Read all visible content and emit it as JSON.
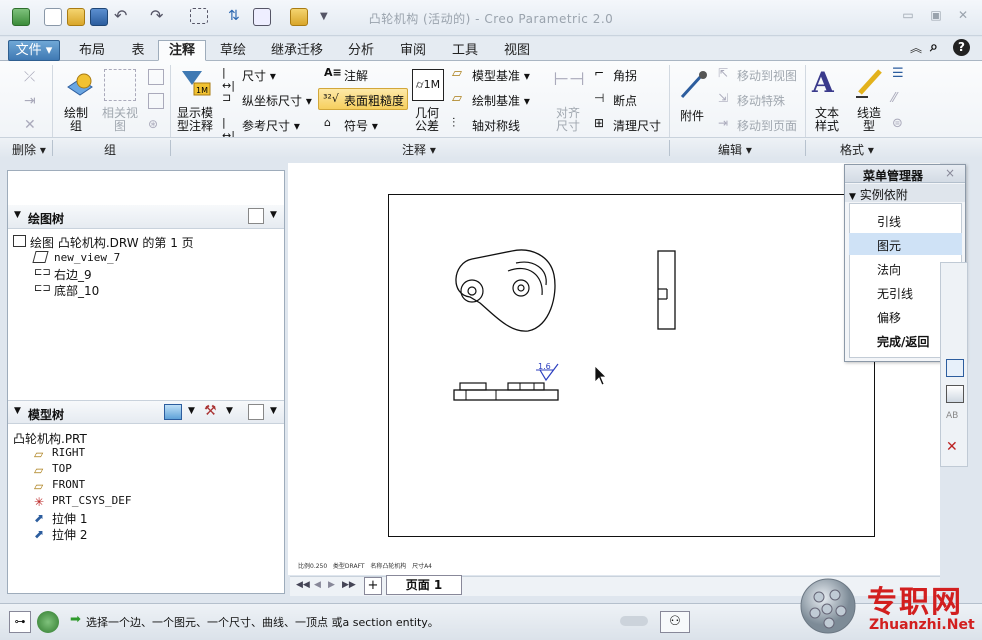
{
  "window": {
    "title": "凸轮机构 (活动的) - Creo Parametric 2.0"
  },
  "tabs": {
    "file": "文件",
    "items": [
      "布局",
      "表",
      "注释",
      "草绘",
      "继承迁移",
      "分析",
      "审阅",
      "工具",
      "视图"
    ],
    "active_index": 2
  },
  "ribbon": {
    "delete": {
      "group_label": "删除"
    },
    "group": {
      "make_group": "绘制\n组",
      "related_view": "相关视\n图",
      "group_label": "组"
    },
    "annotate": {
      "show_model_annotations": "显示模\n型注释",
      "dimension": "尺寸",
      "ordinate_dimension": "纵坐标尺寸",
      "reference_dimension": "参考尺寸",
      "note": "注解",
      "surface_finish": "表面粗糙度",
      "symbol": "符号",
      "geometric_tolerance": "几何\n公差",
      "model_datum": "模型基准",
      "draw_datum": "绘制基准",
      "axis_symmetry": "轴对称线",
      "align_dimensions": "对齐\n尺寸",
      "jog": "角拐",
      "breakpoint": "断点",
      "cleanup_dimensions": "清理尺寸",
      "group_label": "注释"
    },
    "edit": {
      "attach": "附件",
      "move_to_view": "移动到视图",
      "move_special": "移动特殊",
      "move_to_page": "移动到页面",
      "group_label": "编辑"
    },
    "format": {
      "text_style": "文本\n样式",
      "line_style": "线造\n型",
      "group_label": "格式"
    }
  },
  "drawing_tree": {
    "header": "绘图树",
    "root": "绘图 凸轮机构.DRW 的第 1 页",
    "items": [
      "new_view_7",
      "右边_9",
      "底部_10"
    ]
  },
  "model_tree": {
    "header": "模型树",
    "root": "凸轮机构.PRT",
    "items": [
      "RIGHT",
      "TOP",
      "FRONT",
      "PRT_CSYS_DEF",
      "拉伸 1",
      "拉伸 2"
    ]
  },
  "drawing": {
    "surface_finish_value": "1.6"
  },
  "menu_manager": {
    "title": "菜单管理器",
    "section": "实例依附",
    "items": [
      "引线",
      "图元",
      "法向",
      "无引线",
      "偏移",
      "完成/返回"
    ],
    "selected_index": 1
  },
  "page_bar": {
    "page_label": "页面 1",
    "add": "+"
  },
  "sheet_info": [
    "比例0.250",
    "类型DRAFT",
    "名称凸轮机构",
    "尺寸A4"
  ],
  "status": {
    "message": "选择一个边、一个图元、一个尺寸、曲线、一顶点 或a section entity。"
  },
  "watermark": {
    "brand": "专职网",
    "url": "Zhuanzhi.Net"
  },
  "colors": {
    "file_tab": "#3f79b3",
    "menu_selected": "#cfe2f6",
    "watermark_red": "#d21f1f"
  }
}
